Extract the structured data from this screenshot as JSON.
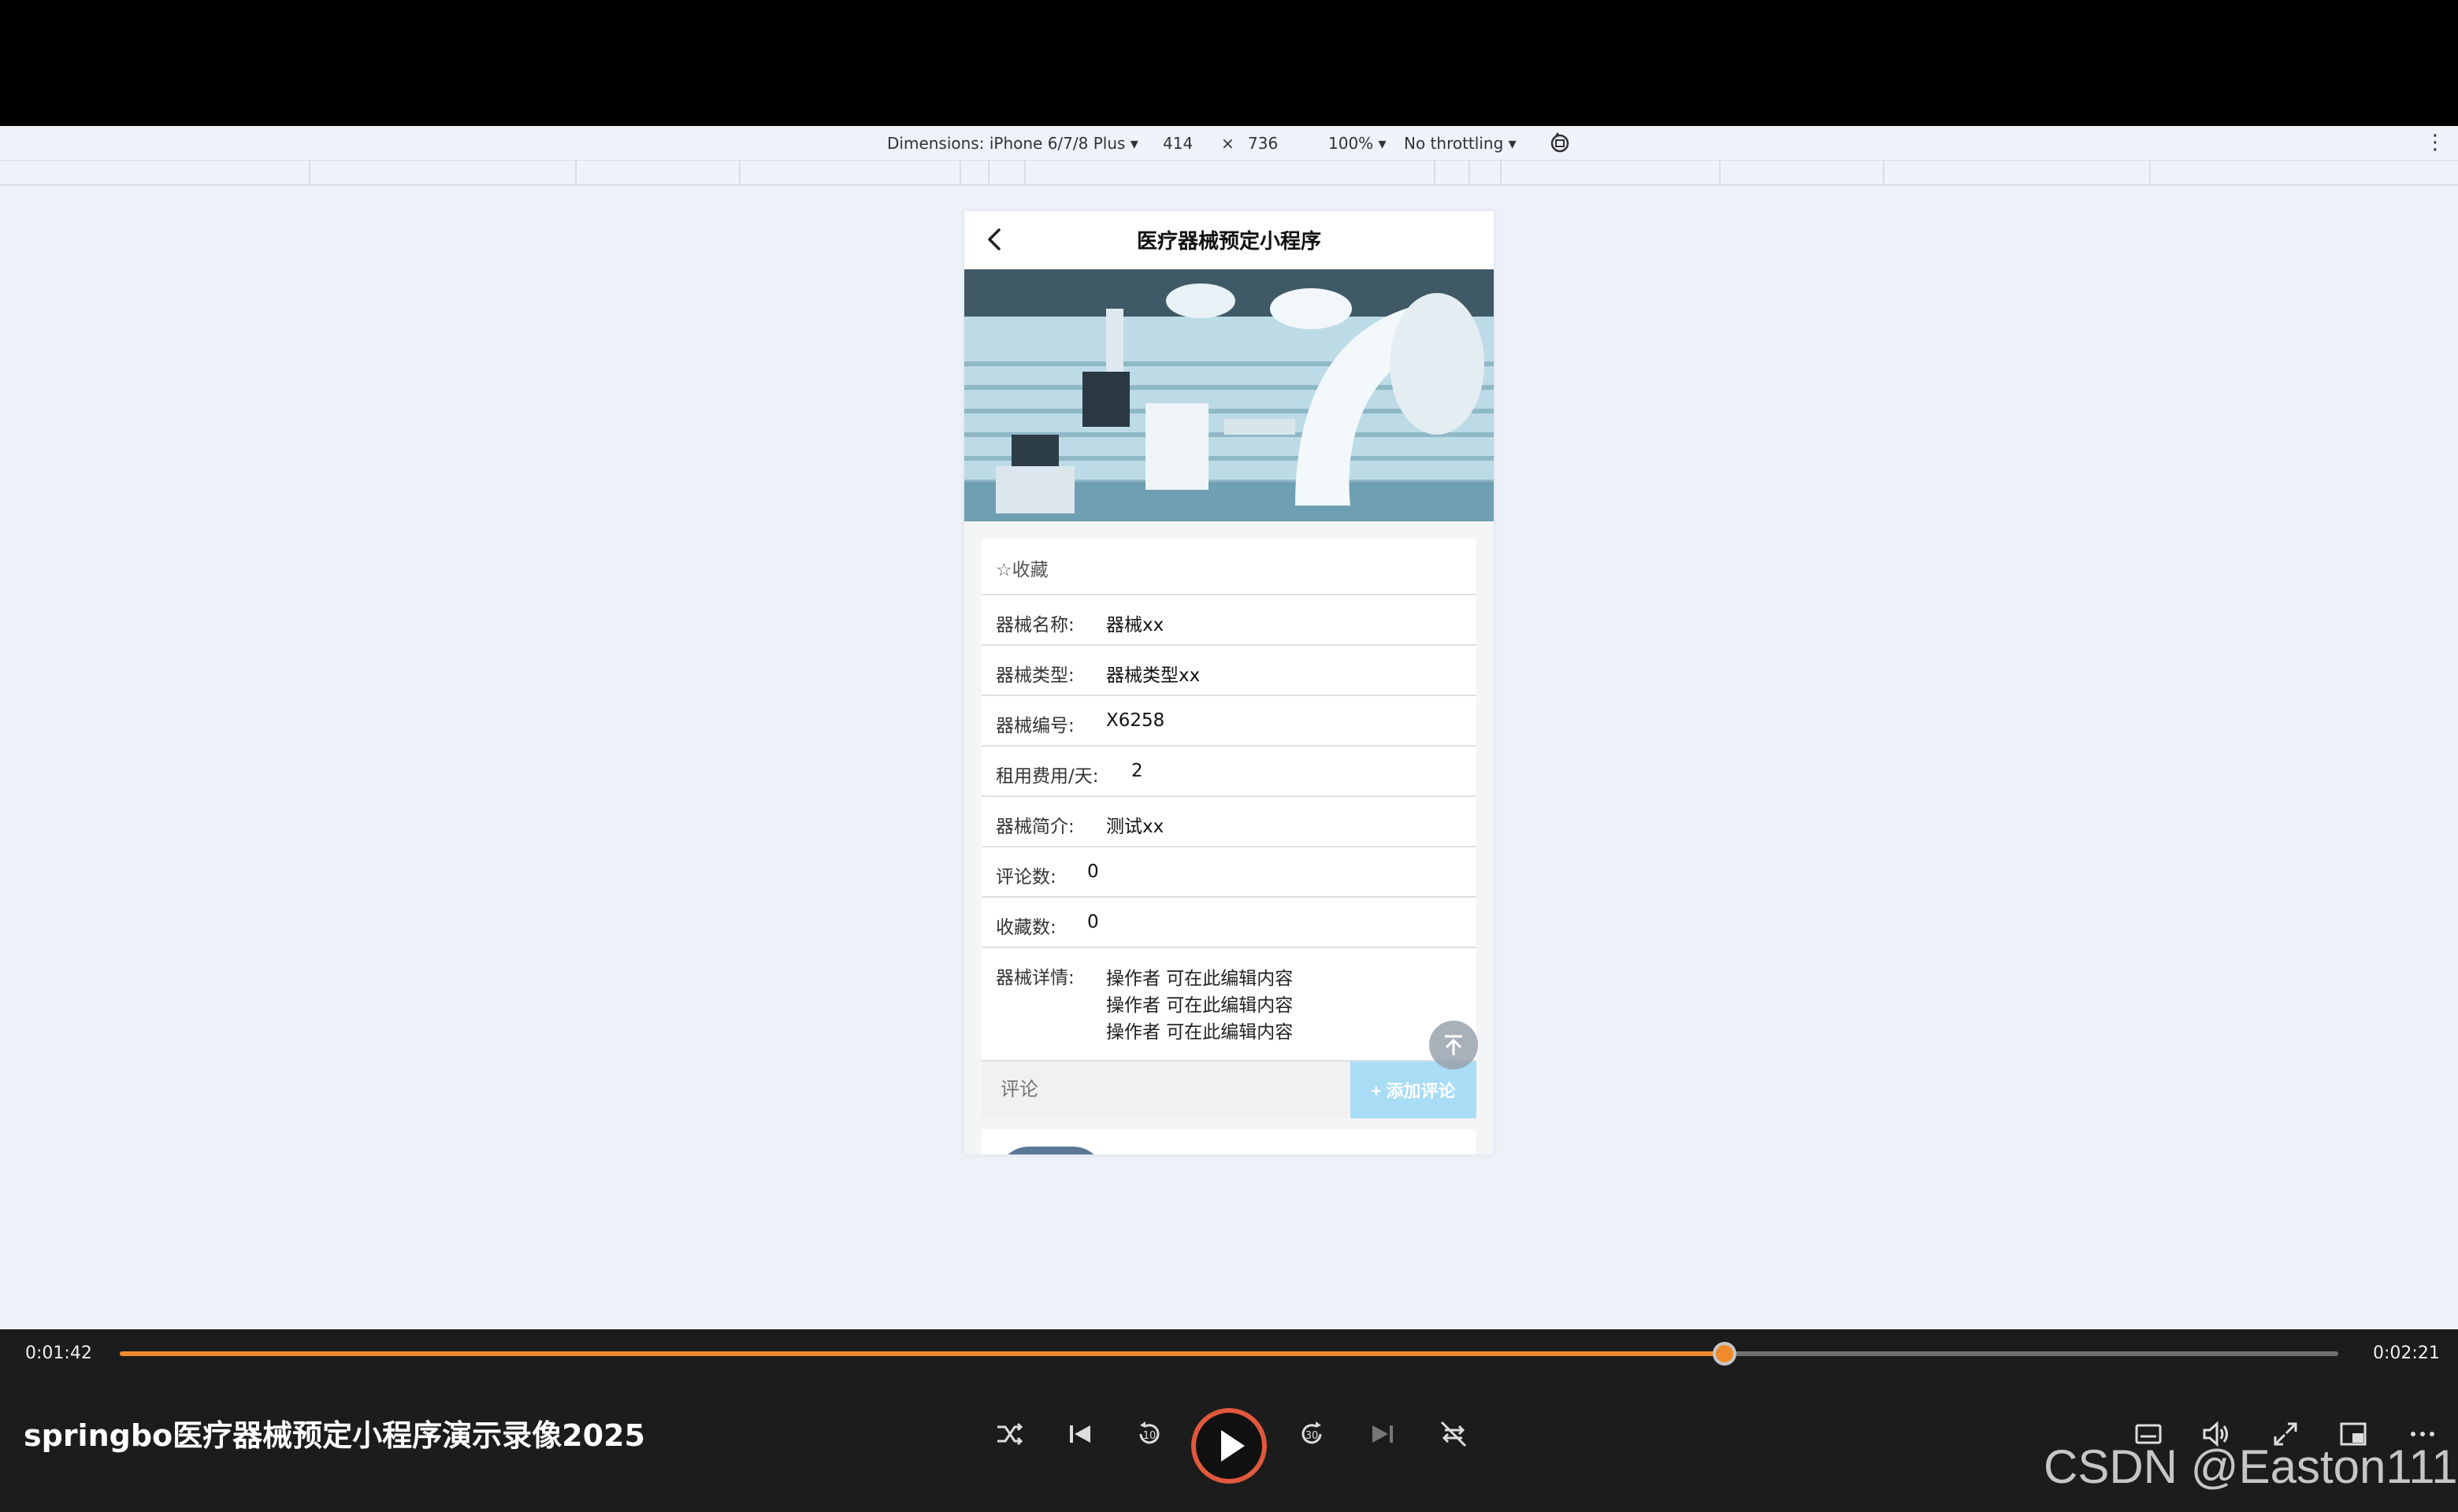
{
  "devtools": {
    "dimensions_label": "Dimensions: iPhone 6/7/8 Plus ▾",
    "width": "414",
    "times": "×",
    "height": "736",
    "zoom": "100% ▾",
    "throttling": "No throttling ▾",
    "more": "⋮"
  },
  "phone": {
    "title": "医疗器械预定小程序",
    "favorite_label": "☆收藏",
    "fields": [
      {
        "label": "器械名称:",
        "value": "器械xx"
      },
      {
        "label": "器械类型:",
        "value": "器械类型xx"
      },
      {
        "label": "器械编号:",
        "value": "X6258"
      },
      {
        "label": "租用费用/天:",
        "value": "2"
      },
      {
        "label": "器械简介:",
        "value": "测试xx"
      },
      {
        "label": "评论数:",
        "value": "0"
      },
      {
        "label": "收藏数:",
        "value": "0"
      }
    ],
    "detail_label": "器械详情:",
    "detail_lines": [
      "操作者 可在此编辑内容",
      "操作者 可在此编辑内容",
      "操作者 可在此编辑内容"
    ],
    "comment_placeholder": "评论",
    "add_comment_label": "+ 添加评论"
  },
  "player": {
    "current_time": "0:01:42",
    "total_time": "0:02:21",
    "progress_fraction": 0.7234,
    "title": "springbo医疗器械预定小程序演示录像2025",
    "watermark": "CSDN @Easton111",
    "accent_color": "#f08a2a"
  }
}
